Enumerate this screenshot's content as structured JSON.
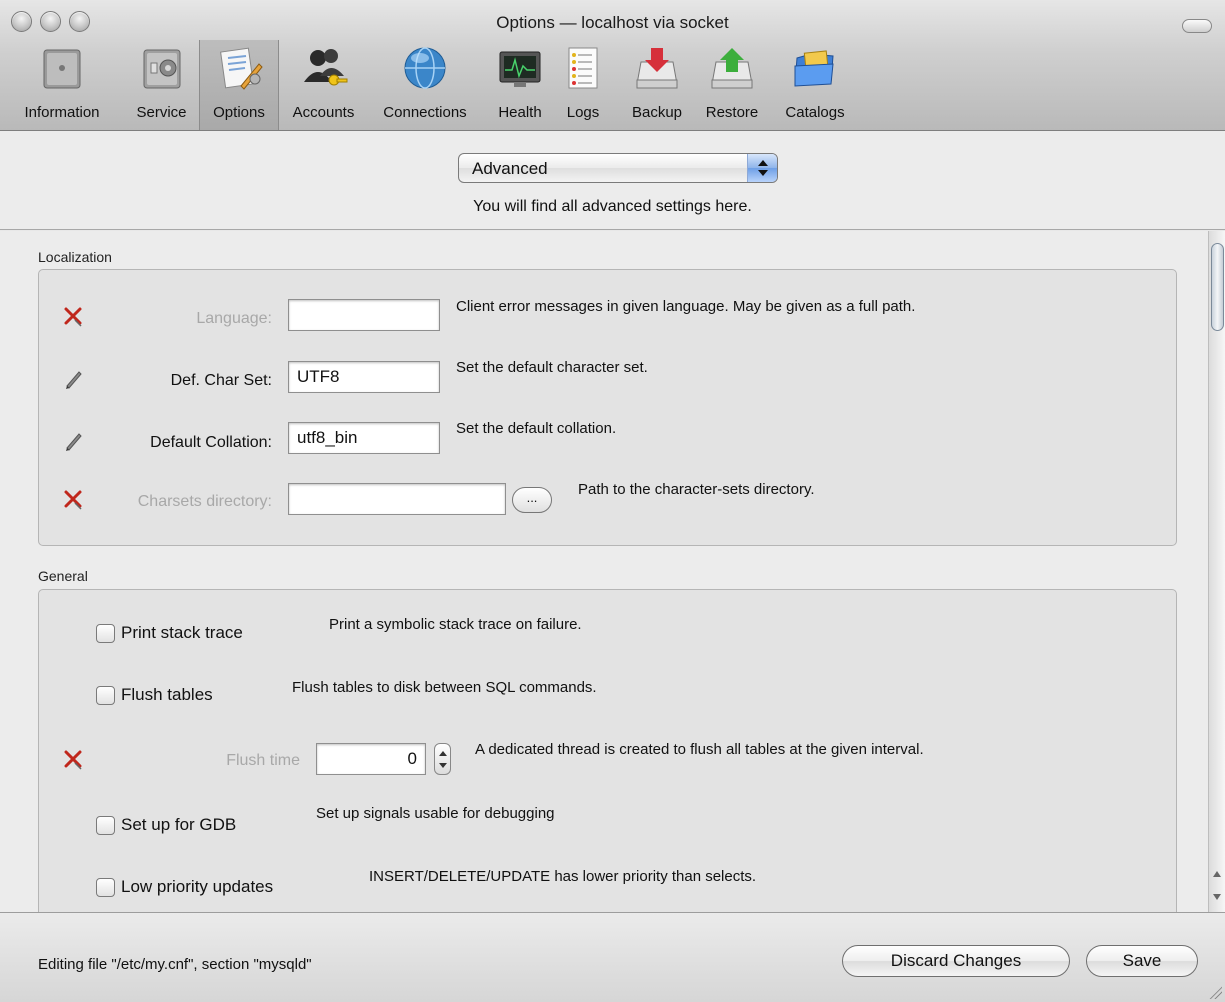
{
  "window": {
    "title": "Options — localhost via socket"
  },
  "toolbar": {
    "items": [
      {
        "label": "Information",
        "icon": "information-icon"
      },
      {
        "label": "Service",
        "icon": "service-icon"
      },
      {
        "label": "Options",
        "icon": "options-icon",
        "selected": true
      },
      {
        "label": "Accounts",
        "icon": "accounts-icon"
      },
      {
        "label": "Connections",
        "icon": "connections-icon"
      },
      {
        "label": "Health",
        "icon": "health-icon"
      },
      {
        "label": "Logs",
        "icon": "logs-icon"
      },
      {
        "label": "Backup",
        "icon": "backup-icon"
      },
      {
        "label": "Restore",
        "icon": "restore-icon"
      },
      {
        "label": "Catalogs",
        "icon": "catalogs-icon"
      }
    ]
  },
  "section_select": {
    "value": "Advanced",
    "description": "You will find all advanced settings here."
  },
  "localization": {
    "title": "Localization",
    "language": {
      "label": "Language:",
      "value": "",
      "description": "Client error messages in given language. May be given as a full path.",
      "state": "disabled"
    },
    "def_char_set": {
      "label": "Def. Char Set:",
      "value": "UTF8",
      "description": "Set the default character set.",
      "state": "edited"
    },
    "default_collation": {
      "label": "Default Collation:",
      "value": "utf8_bin",
      "description": "Set the default collation.",
      "state": "edited"
    },
    "charsets_directory": {
      "label": "Charsets directory:",
      "value": "",
      "browse_label": "...",
      "description": "Path to the character-sets directory.",
      "state": "disabled"
    }
  },
  "general": {
    "title": "General",
    "print_stack_trace": {
      "label": "Print stack trace",
      "checked": false,
      "description": "Print a symbolic stack trace on failure."
    },
    "flush_tables": {
      "label": "Flush tables",
      "checked": false,
      "description": "Flush tables to disk between SQL commands."
    },
    "flush_time": {
      "label": "Flush time",
      "value": "0",
      "description": "A dedicated thread is created to flush all tables at the given interval.",
      "state": "disabled"
    },
    "set_up_for_gdb": {
      "label": "Set up for GDB",
      "checked": false,
      "description": "Set up signals usable for debugging"
    },
    "low_priority_updates": {
      "label": "Low priority updates",
      "checked": false,
      "description": "INSERT/DELETE/UPDATE has lower priority than selects."
    }
  },
  "footer": {
    "status": "Editing file \"/etc/my.cnf\", section \"mysqld\"",
    "discard_label": "Discard Changes",
    "save_label": "Save"
  },
  "colors": {
    "disabled_text": "#a8a8a8",
    "x_mark": "#c0271c",
    "selection_blue": "#6e9fe6"
  }
}
